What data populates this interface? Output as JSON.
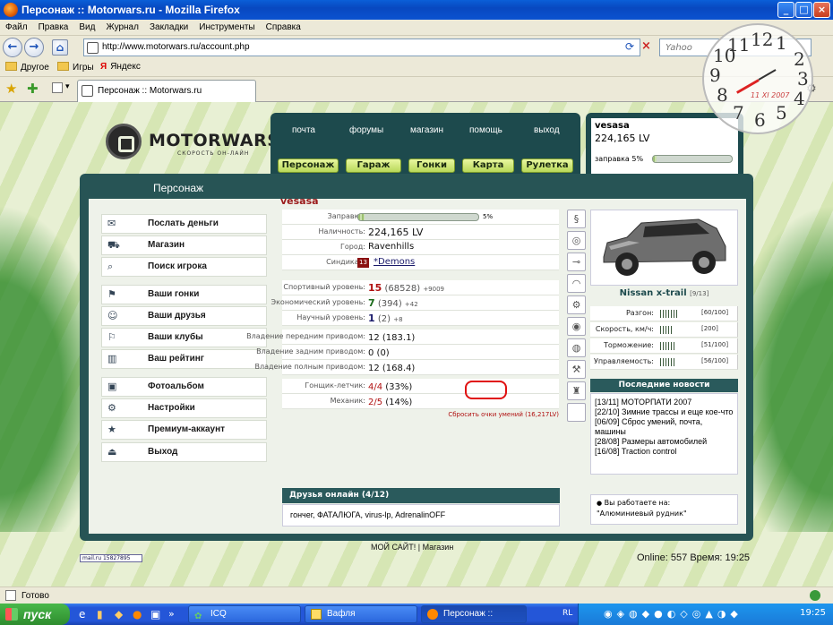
{
  "window": {
    "title": "Персонаж :: Motorwars.ru - Mozilla Firefox"
  },
  "menu": [
    "Файл",
    "Правка",
    "Вид",
    "Журнал",
    "Закладки",
    "Инструменты",
    "Справка"
  ],
  "nav": {
    "url": "http://www.motorwars.ru/account.php",
    "search_placeholder": "Yahoo"
  },
  "bookmarks": [
    "Другое",
    "Игры",
    "Яндекс"
  ],
  "tab": {
    "label": "Персонаж :: Motorwars.ru"
  },
  "site": {
    "logo_name": "MOTORWARS.RU",
    "logo_sub": "СКОРОСТЬ ОН-ЛАЙН",
    "top_links": [
      "почта",
      "форумы",
      "магазин",
      "помощь",
      "выход"
    ],
    "top_buttons": [
      "Персонаж",
      "Гараж",
      "Гонки",
      "Карта",
      "Рулетка"
    ],
    "user": {
      "name": "vesasa",
      "money": "224,165 LV",
      "fuel_label": "заправка 5%",
      "fuel_percent": 5
    },
    "panel_title": "Персонаж",
    "left_menu": [
      {
        "label": "Послать деньги",
        "icon": "send-money-icon",
        "glyph": "✉"
      },
      {
        "label": "Магазин",
        "icon": "shop-icon",
        "glyph": "⛟"
      },
      {
        "label": "Поиск игрока",
        "icon": "search-player-icon",
        "glyph": "⌕"
      },
      {
        "label": "Ваши гонки",
        "icon": "races-icon",
        "glyph": "⚑"
      },
      {
        "label": "Ваши друзья",
        "icon": "friends-icon",
        "glyph": "☺"
      },
      {
        "label": "Ваши клубы",
        "icon": "clubs-icon",
        "glyph": "⚐"
      },
      {
        "label": "Ваш рейтинг",
        "icon": "rating-icon",
        "glyph": "▥"
      },
      {
        "label": "Фотоальбом",
        "icon": "photoalbum-icon",
        "glyph": "▣"
      },
      {
        "label": "Настройки",
        "icon": "settings-icon",
        "glyph": "⚙"
      },
      {
        "label": "Премиум-аккаунт",
        "icon": "premium-icon",
        "glyph": "★"
      },
      {
        "label": "Выход",
        "icon": "exit-icon",
        "glyph": "⏏"
      }
    ],
    "character": {
      "name": "vesasa",
      "fuel_label": "Заправка:",
      "fuel_value": "5%",
      "fuel_percent": 5,
      "cash_label": "Наличность:",
      "cash_value": "224,165 LV",
      "city_label": "Город:",
      "city_value": "Ravenhills",
      "syndicate_label": "Синдикат:",
      "syndicate_value": "*Demons",
      "sport_label": "Спортивный уровень:",
      "sport_level": "15",
      "sport_points": "(68528)",
      "sport_bonus": "+9009",
      "econ_label": "Экономический уровень:",
      "econ_level": "7",
      "econ_points": "(394)",
      "econ_bonus": "+42",
      "sci_label": "Научный уровень:",
      "sci_level": "1",
      "sci_points": "(2)",
      "sci_bonus": "+8",
      "fwd_label": "Владение передним приводом:",
      "fwd_value": "12 (183.1)",
      "rwd_label": "Владение задним приводом:",
      "rwd_value": "0 (0)",
      "awd_label": "Владение полным приводом:",
      "awd_value": "12 (168.4)",
      "pilot_label": "Гонщик-летчик:",
      "pilot_value": "4/4",
      "pilot_pct": "(33%)",
      "mech_label": "Механик:",
      "mech_value": "2/5",
      "mech_pct": "(14%)",
      "reset_text": "Сбросить очки умений (16,217LV)"
    },
    "car": {
      "name": "Nissan x-trail",
      "slot": "[9/13]",
      "stats": [
        {
          "label": "Разгон:",
          "value": "[60/100]"
        },
        {
          "label": "Скорость, км/ч:",
          "value": "[200]"
        },
        {
          "label": "Торможение:",
          "value": "[51/100]"
        },
        {
          "label": "Управляемость:",
          "value": "[56/100]"
        }
      ]
    },
    "news": {
      "title": "Последние новости",
      "items": [
        "[13/11] МОТОРПАТИ 2007",
        "[22/10] Зимние трассы и еще кое-что",
        "[06/09] Сброс умений, почта, машины",
        "[28/08] Размеры автомобилей",
        "[16/08] Traction control"
      ]
    },
    "work": {
      "line1": "Вы работаете на:",
      "line2": "\"Алюминиевый рудник\""
    },
    "friends": {
      "title": "Друзья онлайн (4/12)",
      "list": "гончег, ФАТАЛЮГА, virus-lp, AdrenalinOFF"
    },
    "footer_links": "МОЙ САЙТ! | Магазин",
    "online": "Online: 557  Время: 19:25",
    "counter": "15827895"
  },
  "clock_overlay": {
    "date": "11 XI 2007"
  },
  "status": "Готово",
  "taskbar": {
    "start": "пуск",
    "items": [
      "ICQ",
      "Вафля",
      "Персонаж :: Motorw..."
    ],
    "lang": "RL",
    "time": "19:25"
  }
}
